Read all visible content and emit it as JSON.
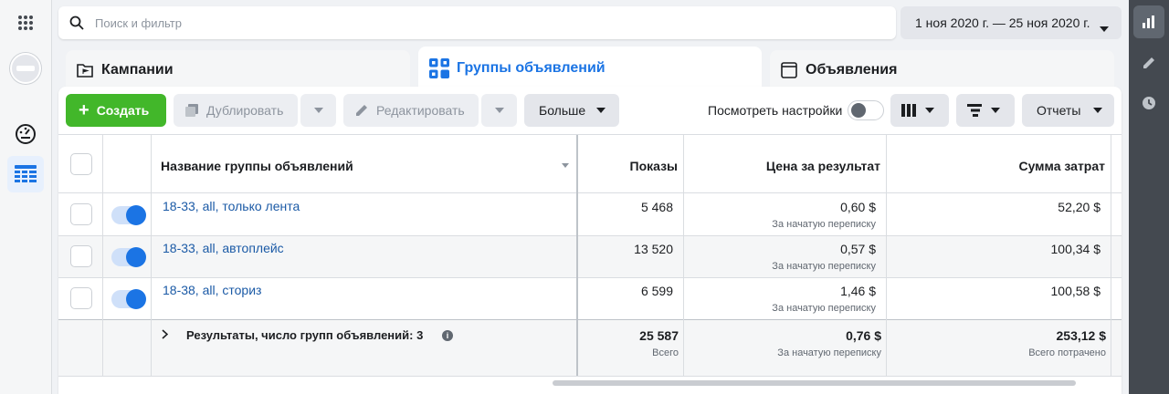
{
  "search": {
    "placeholder": "Поиск и фильтр"
  },
  "date_range": {
    "label": "1 ноя 2020 г. — 25 ноя 2020 г."
  },
  "tabs": [
    {
      "label": "Кампании",
      "icon": "folder-flag-icon"
    },
    {
      "label": "Группы объявлений",
      "icon": "grid-icon"
    },
    {
      "label": "Объявления",
      "icon": "ad-frame-icon"
    }
  ],
  "toolbar": {
    "create": "Создать",
    "duplicate": "Дублировать",
    "edit": "Редактировать",
    "more": "Больше",
    "view_settings": "Посмотреть настройки",
    "reports": "Отчеты"
  },
  "table": {
    "columns": {
      "name": "Название группы объявлений",
      "impressions": "Показы",
      "cost": "Цена за результат",
      "spend": "Сумма затрат"
    },
    "rows": [
      {
        "name": "18-33, all, только лента",
        "impressions": "5 468",
        "cost": "0,60 $",
        "cost_sub": "За начатую переписку",
        "spend": "52,20 $"
      },
      {
        "name": "18-33, all, автоплейс",
        "impressions": "13 520",
        "cost": "0,57 $",
        "cost_sub": "За начатую переписку",
        "spend": "100,34 $"
      },
      {
        "name": "18-38, all, сториз",
        "impressions": "6 599",
        "cost": "1,46 $",
        "cost_sub": "За начатую переписку",
        "spend": "100,58 $"
      }
    ],
    "total": {
      "label": "Результаты, число групп объявлений: 3",
      "impressions": "25 587",
      "impressions_sub": "Всего",
      "cost": "0,76 $",
      "cost_sub": "За начатую переписку",
      "spend": "253,12 $",
      "spend_sub": "Всего потрачено"
    }
  },
  "colors": {
    "accent": "#1b74e4",
    "create_button": "#42b72a",
    "link": "#1b5aa6"
  }
}
